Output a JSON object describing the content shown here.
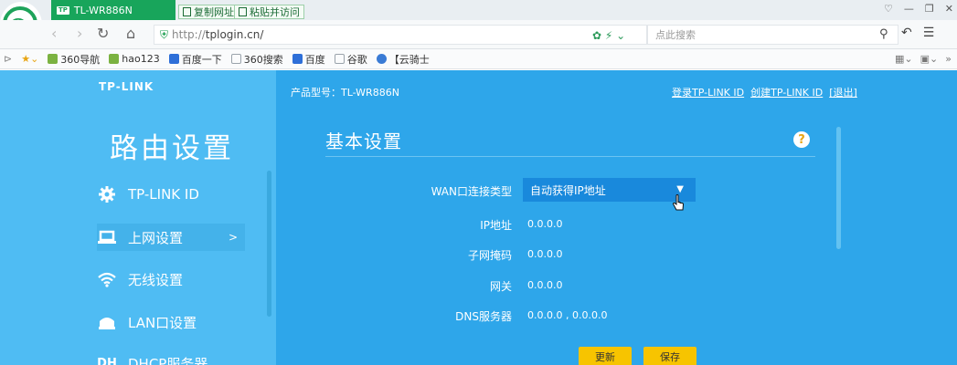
{
  "browser": {
    "tab_title": "TL-WR886N",
    "tab_badge": "TP",
    "copy_url_label": "复制网址",
    "paste_visit_label": "粘贴并访问",
    "address_protocol": "http://",
    "address_host": "tplogin.cn/",
    "search_placeholder": "点此搜索"
  },
  "bookmarks": [
    {
      "label": "360导航",
      "color": "#7bb241"
    },
    {
      "label": "hao123",
      "color": "#7bb241"
    },
    {
      "label": "百度一下",
      "color": "#2e6fd8"
    },
    {
      "label": "360搜索",
      "color": "#9aa3ab"
    },
    {
      "label": "百度",
      "color": "#2e6fd8"
    },
    {
      "label": "谷歌",
      "color": "#9aa3ab"
    },
    {
      "label": "【云骑士",
      "color": "#3a7bd5"
    }
  ],
  "router": {
    "brand": "TP-LINK",
    "side_title": "路由设置",
    "menu": [
      {
        "label": "TP-LINK ID",
        "icon": "gear-icon"
      },
      {
        "label": "上网设置",
        "icon": "laptop-icon",
        "arrow": ">"
      },
      {
        "label": "无线设置",
        "icon": "wifi-icon"
      },
      {
        "label": "LAN口设置",
        "icon": "lan-icon"
      },
      {
        "label": "DHCP服务器",
        "icon": "dhcp-icon",
        "icon_text": "DH"
      }
    ],
    "model_label": "产品型号：TL-WR886N",
    "links": {
      "login": "登录TP-LINK ID",
      "create": "创建TP-LINK ID",
      "logout": "[退出]"
    },
    "panel": {
      "title": "基本设置",
      "help": "?",
      "wan_label": "WAN口连接类型",
      "wan_value": "自动获得IP地址",
      "fields": [
        {
          "label": "IP地址",
          "value": "0.0.0.0"
        },
        {
          "label": "子网掩码",
          "value": "0.0.0.0"
        },
        {
          "label": "网关",
          "value": "0.0.0.0"
        },
        {
          "label": "DNS服务器",
          "value": "0.0.0.0 , 0.0.0.0"
        }
      ],
      "refresh_label": "更新",
      "save_label": "保存"
    }
  },
  "colors": {
    "page_bg": "#2ea6ea",
    "sidebar_bg": "#4fbcf3",
    "button_yellow": "#f7c400",
    "select_bg": "#1989dc",
    "tab_green": "#18a55b"
  }
}
